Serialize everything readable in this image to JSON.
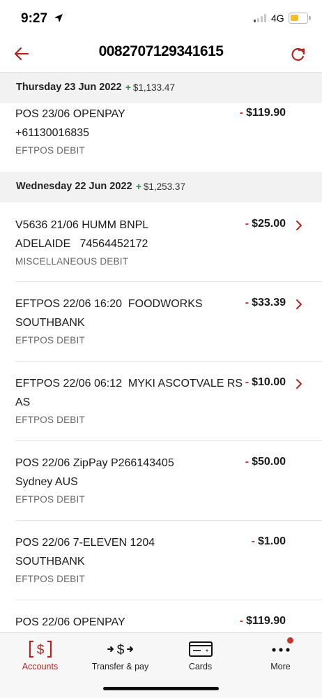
{
  "status_bar": {
    "time": "9:27",
    "network": "4G"
  },
  "header": {
    "title": "0082707129341615"
  },
  "groups": [
    {
      "date": "Thursday 23 Jun 2022",
      "amount": "$1,133.47",
      "transactions": [
        {
          "desc1": "POS 23/06 OPENPAY",
          "desc2": "+61130016835",
          "type": "EFTPOS DEBIT",
          "amount": "$119.90",
          "chevron": false
        }
      ]
    },
    {
      "date": "Wednesday 22 Jun 2022",
      "amount": "$1,253.37",
      "transactions": [
        {
          "desc1": "V5636 21/06 HUMM BNPL",
          "desc2": "ADELAIDE   74564452172",
          "type": "MISCELLANEOUS DEBIT",
          "amount": "$25.00",
          "chevron": true
        },
        {
          "desc1": "EFTPOS 22/06 16:20  FOODWORKS",
          "desc2": "SOUTHBANK",
          "type": "EFTPOS DEBIT",
          "amount": "$33.39",
          "chevron": true
        },
        {
          "desc1": "EFTPOS 22/06 06:12  MYKI ASCOTVALE RS",
          "desc2": "AS",
          "type": "EFTPOS DEBIT",
          "amount": "$10.00",
          "chevron": true
        },
        {
          "desc1": "POS 22/06 ZipPay P266143405",
          "desc2": "Sydney AUS",
          "type": "EFTPOS DEBIT",
          "amount": "$50.00",
          "chevron": false
        },
        {
          "desc1": "POS 22/06 7-ELEVEN 1204",
          "desc2": "SOUTHBANK",
          "type": "EFTPOS DEBIT",
          "amount": "$1.00",
          "chevron": false
        },
        {
          "desc1": "POS 22/06 OPENPAY",
          "desc2": "",
          "type": "",
          "amount": "$119.90",
          "chevron": false
        }
      ]
    }
  ],
  "sign": {
    "plus": "+",
    "minus": "-"
  },
  "bottom_nav": [
    {
      "label": "Accounts",
      "icon": "accounts-icon",
      "active": true
    },
    {
      "label": "Transfer & pay",
      "icon": "transfer-icon",
      "active": false
    },
    {
      "label": "Cards",
      "icon": "card-icon",
      "active": false
    },
    {
      "label": "More",
      "icon": "more-icon",
      "active": false,
      "badge": true
    }
  ],
  "colors": {
    "accent": "#b3261e",
    "credit": "#2e8b3e",
    "debit": "#c0392b"
  }
}
